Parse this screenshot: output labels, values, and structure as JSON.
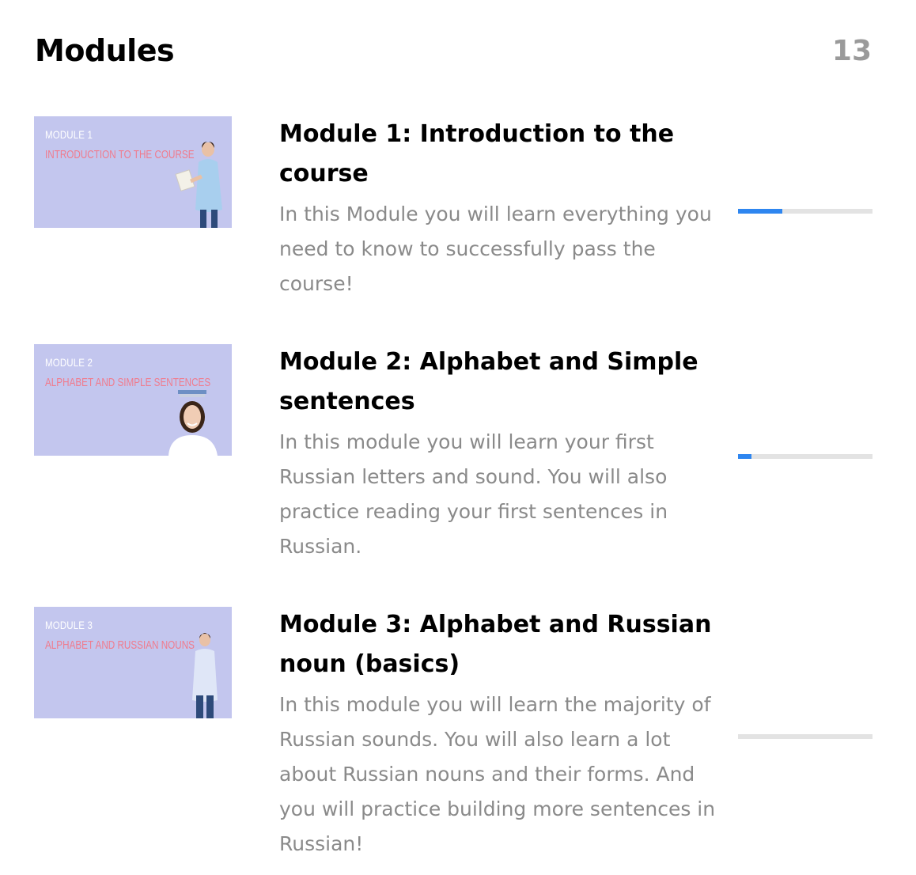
{
  "header": {
    "title": "Modules",
    "count": "13"
  },
  "modules": [
    {
      "thumb_line1": "MODULE 1",
      "thumb_line2": "INTRODUCTION TO THE COURSE",
      "title": "Module 1: Introduction to the course",
      "description": "In this Module you will learn everything you need to know to successfully pass the course!",
      "progress": 0.33
    },
    {
      "thumb_line1": "MODULE 2",
      "thumb_line2": "ALPHABET AND SIMPLE SENTENCES",
      "title": "Module 2: Alphabet and Simple sentences",
      "description": "In this module you will learn your first Russian letters and sound. You will also practice reading your first sentences in Russian.",
      "progress": 0.1
    },
    {
      "thumb_line1": "MODULE 3",
      "thumb_line2": "ALPHABET AND RUSSIAN NOUNS",
      "title": "Module 3: Alphabet and Russian noun (basics)",
      "description": "In this module you will learn the majority of Russian sounds. You will also learn a lot about Russian nouns and their forms. And you will practice building more sentences in Russian!",
      "progress": 0
    }
  ],
  "colors": {
    "thumb_bg": "#c3c6ee",
    "thumb_accent": "#f07b8d",
    "progress_fill": "#2e86f0",
    "progress_track": "#e3e3e3",
    "description_text": "#8a8a8a",
    "count_text": "#9a9a9a"
  }
}
